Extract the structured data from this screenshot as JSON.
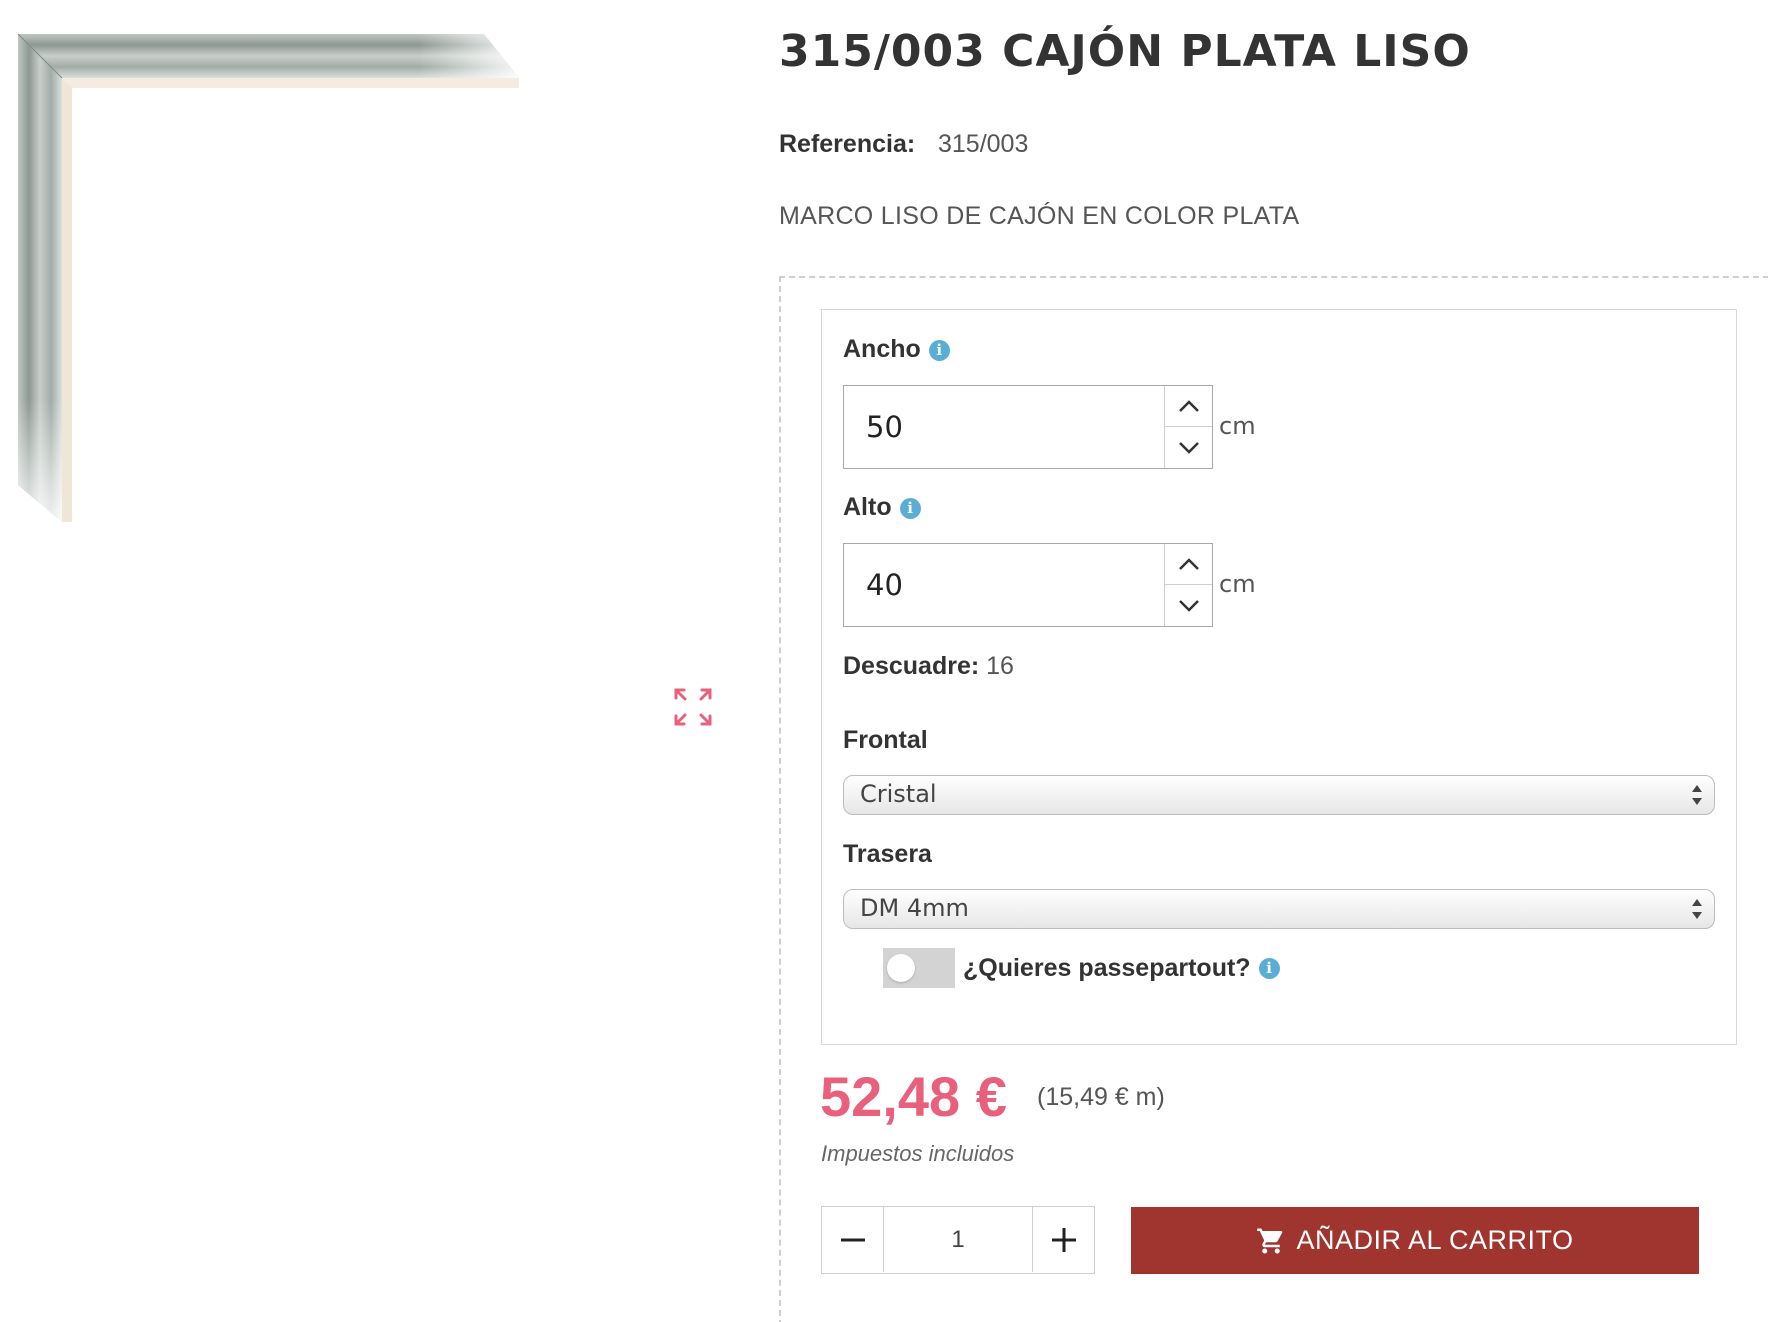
{
  "product": {
    "title": "315/003 CAJÓN PLATA LISO",
    "reference_label": "Referencia:",
    "reference_value": "315/003",
    "description": "MARCO LISO DE CAJÓN EN COLOR PLATA"
  },
  "config": {
    "ancho": {
      "label": "Ancho",
      "value": "50",
      "unit": "cm",
      "info_icon": "info-icon"
    },
    "alto": {
      "label": "Alto",
      "value": "40",
      "unit": "cm",
      "info_icon": "info-icon"
    },
    "descuadre": {
      "label": "Descuadre:",
      "value": "16"
    },
    "frontal": {
      "label": "Frontal",
      "selected": "Cristal"
    },
    "trasera": {
      "label": "Trasera",
      "selected": "DM 4mm"
    },
    "passepartout": {
      "label": "¿Quieres passepartout?",
      "enabled": false
    }
  },
  "pricing": {
    "price": "52,48 €",
    "unit_price": "(15,49 € m)",
    "tax_note": "Impuestos incluidos"
  },
  "cart": {
    "quantity": "1",
    "add_label": "AÑADIR AL CARRITO",
    "icon": "cart-icon"
  },
  "colors": {
    "accent_price": "#e8607b",
    "cart_button": "#a03530",
    "info_icon": "#5aaed6",
    "expand_icon": "#e8607b"
  }
}
